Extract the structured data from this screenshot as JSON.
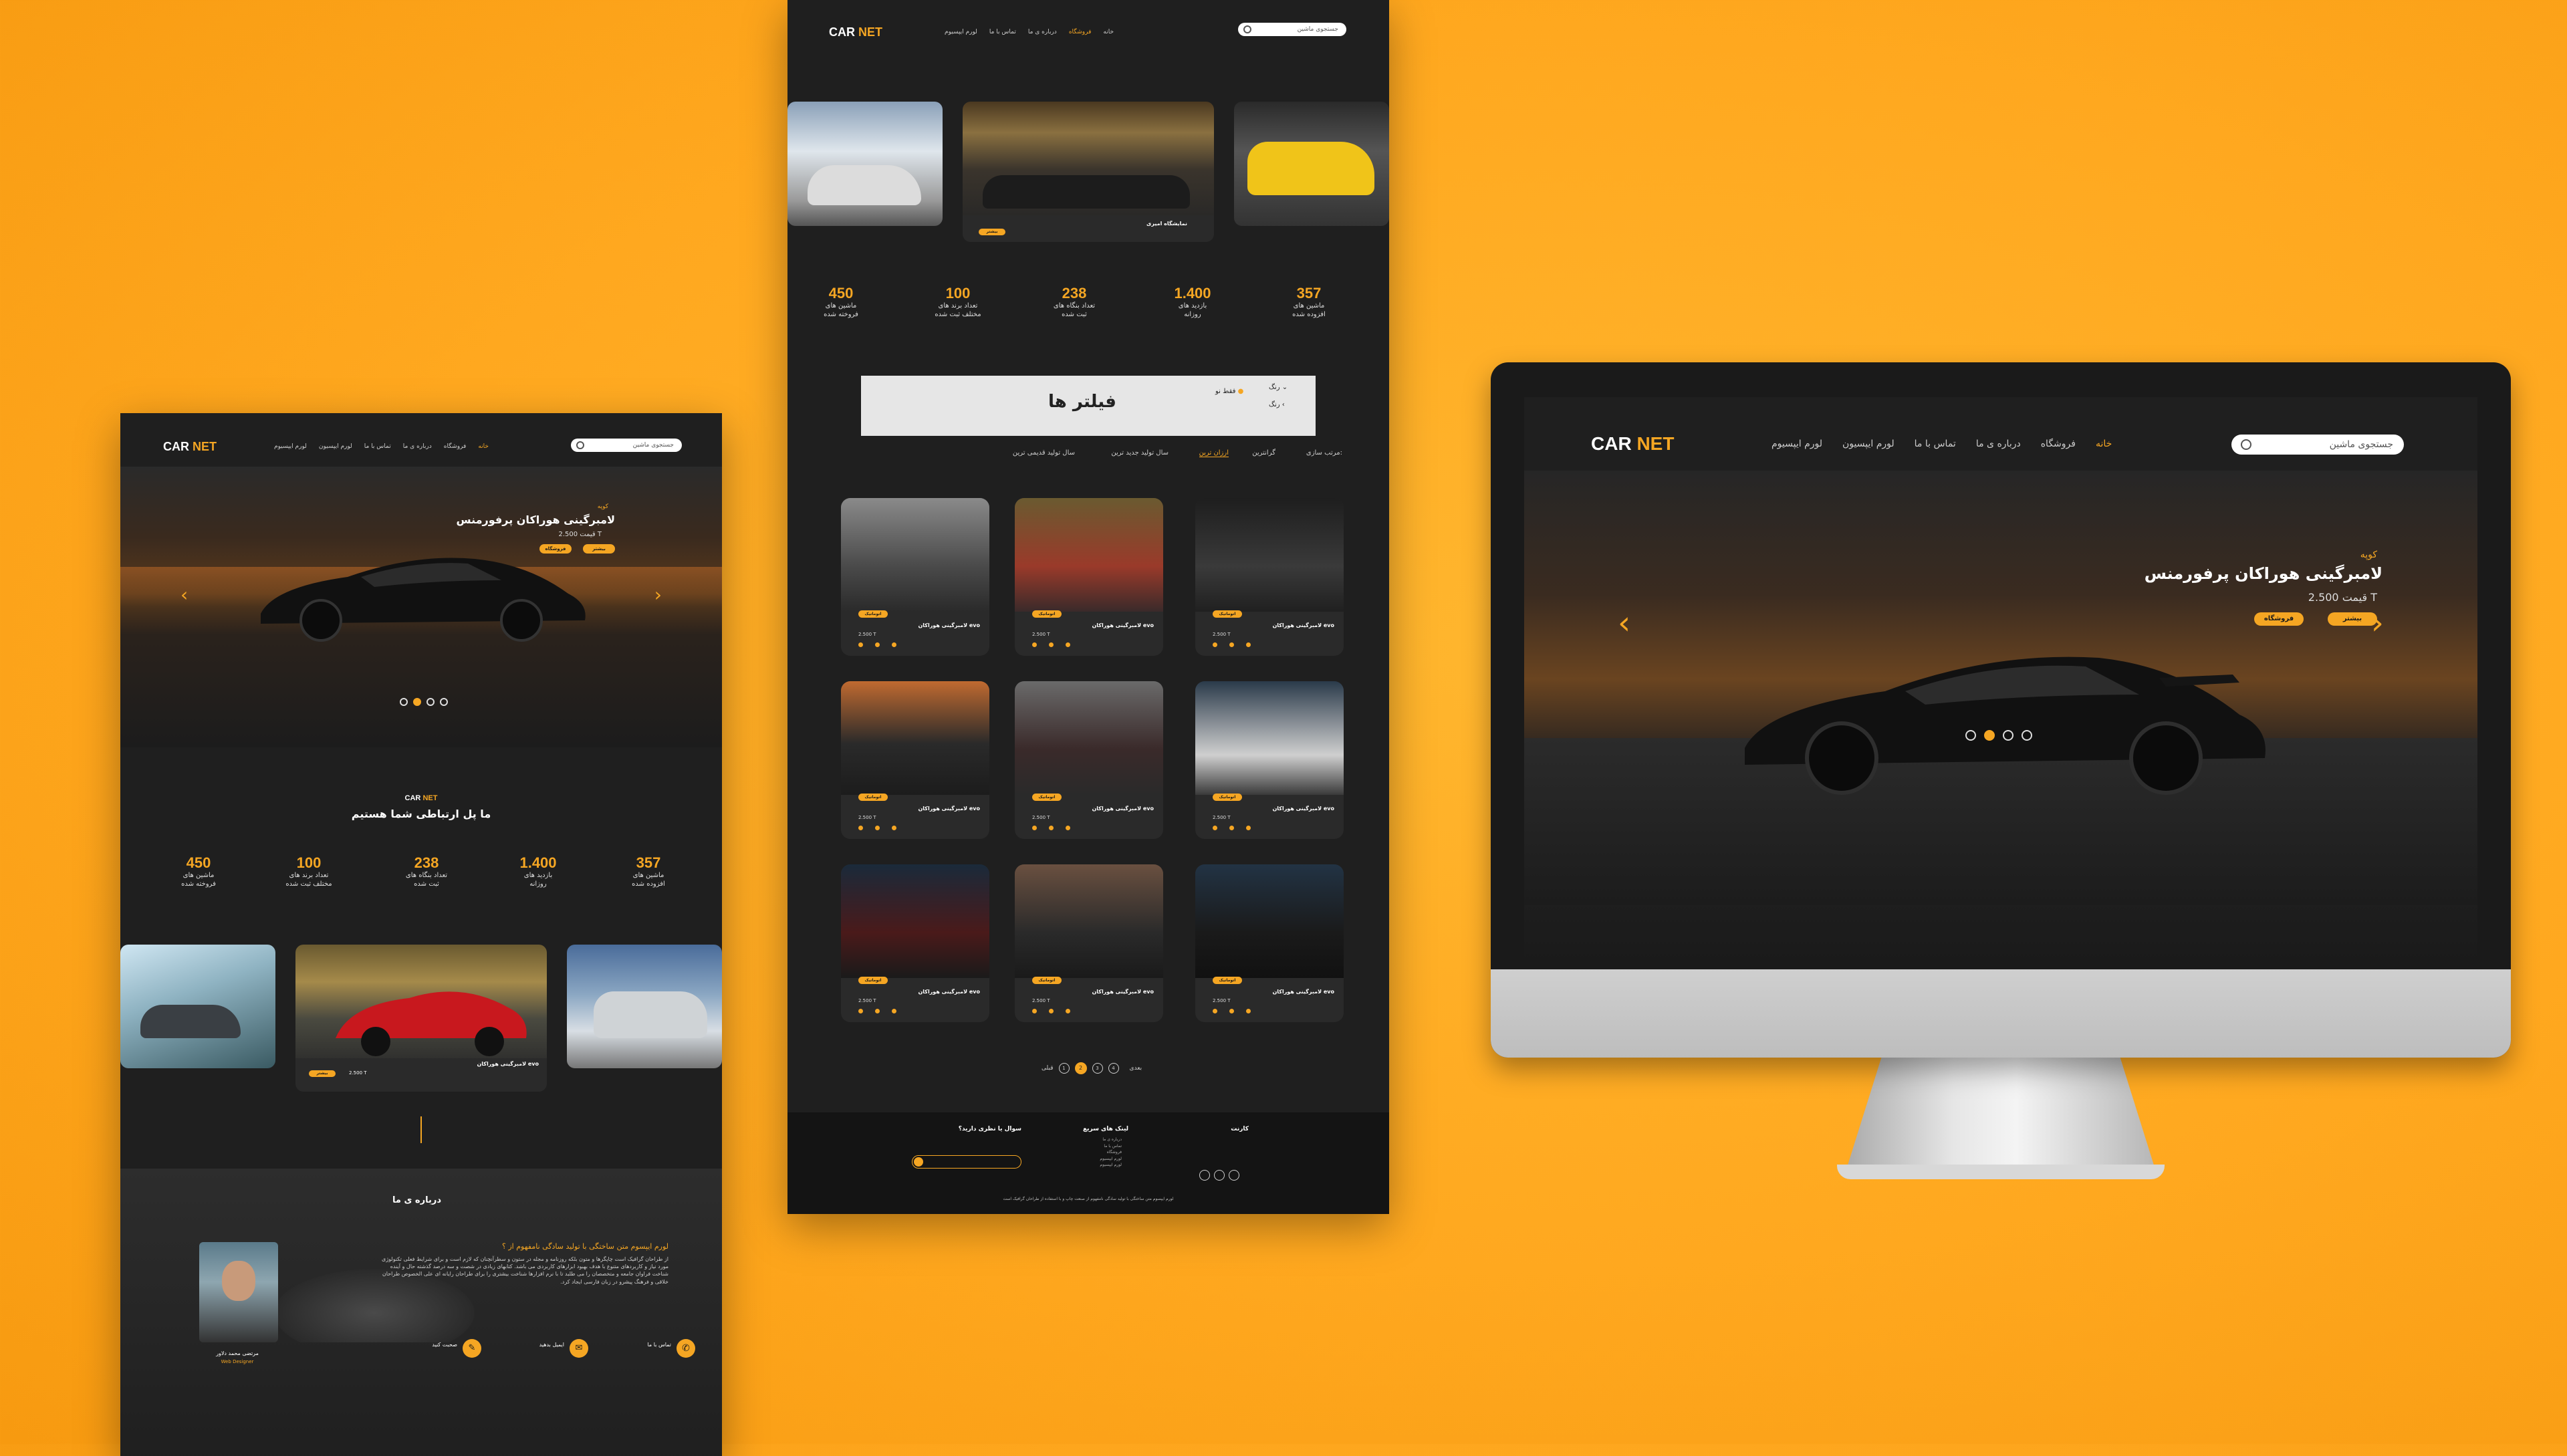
{
  "brand": {
    "car": "CAR",
    "net": "NET"
  },
  "nav": {
    "home": "خانه",
    "shop": "فروشگاه",
    "about": "درباره ی ما",
    "contact": "تماس با ما",
    "lorem1": "لورم ایپسیوم",
    "lorem2": "لورم ایپسیون"
  },
  "search_placeholder": "جستجوی ماشین",
  "hero": {
    "category": "کوپه",
    "title": "لامبرگینی هوراکان پرفورمنس",
    "price_label": "قیمت",
    "price": "2.500 T",
    "btn_shop": "فروشگاه",
    "btn_more": "بیشتر"
  },
  "intro": {
    "title": "ما پل ارتباطی شما هستیم"
  },
  "stats": [
    {
      "value": "357",
      "label1": "ماشین های",
      "label2": "افزوده شده"
    },
    {
      "value": "1.400",
      "label1": "بازدید های",
      "label2": "روزانه"
    },
    {
      "value": "238",
      "label1": "تعداد بنگاه های",
      "label2": "ثبت شده"
    },
    {
      "value": "100",
      "label1": "تعداد برند های",
      "label2": "مختلف ثبت شده"
    },
    {
      "value": "450",
      "label1": "ماشین های",
      "label2": "فروخته شده"
    }
  ],
  "filters": {
    "title": "فیلتر ها",
    "color_label": "رنگ",
    "only_new": "فقط نو",
    "sort_label": "مرتب سازی:",
    "sort_options": [
      "گرانترین",
      "ارزان ترین",
      "سال تولید جدید ترین",
      "سال تولید قدیمی ترین"
    ]
  },
  "showroom": {
    "name": "نمایشگاه امیری",
    "more": "بیشتر"
  },
  "product": {
    "name": "لامبرگینی هوراکان evo",
    "badge": "اتوماتیک",
    "price": "2.500 T"
  },
  "pagination": {
    "next": "بعدی",
    "prev": "قبلی",
    "pages": [
      "1",
      "2",
      "3",
      "4"
    ]
  },
  "footer": {
    "col1": "کارنت",
    "col2": "لینک های سریع",
    "col3": "سوال یا نظری دارید؟",
    "links": [
      "درباره ی ما",
      "تماس با ما",
      "فروشگاه",
      "لورم ایپسیوم",
      "لورم ایپسیوم"
    ],
    "copyright": "لورم ایپسوم متن ساختگی با تولید سادگی نامفهوم از صنعت چاپ و با استفاده از طراحان گرافیک است"
  },
  "about": {
    "title": "درباره ی ما",
    "subtitle": "لورم ایپسوم متن ساختگی با تولید سادگی نامفهوم از ؟",
    "body": "از طراحان گرافیک است چاپگرها و متون بلکه روزنامه و مجله در ستون و سطرآنچنان که لازم است و برای شرایط فعلی تکنولوژی مورد نیاز و کاربردهای متنوع با هدف بهبود ابزارهای کاربردی می باشد. کتابهای زیادی در شصت و سه درصد گذشته حال و آینده شناخت فراوان جامعه و متخصصان را می طلبد تا با نرم افزارها شناخت بیشتری را برای طراحان رایانه ای علی الخصوص طراحان خلاقی و فرهنگ پیشرو در زبان فارسی ایجاد کرد.",
    "person_name": "مرتضی محمد دلاور",
    "person_role": "Web Designer",
    "contact_email_label": "ایمیل بدهید",
    "contact_phone_label": "تماس با ما",
    "contact_chat_label": "صحبت کنید"
  },
  "colors": {
    "accent": "#f5a623",
    "panel": "#1f1f1f",
    "background": "#ffa81f"
  }
}
